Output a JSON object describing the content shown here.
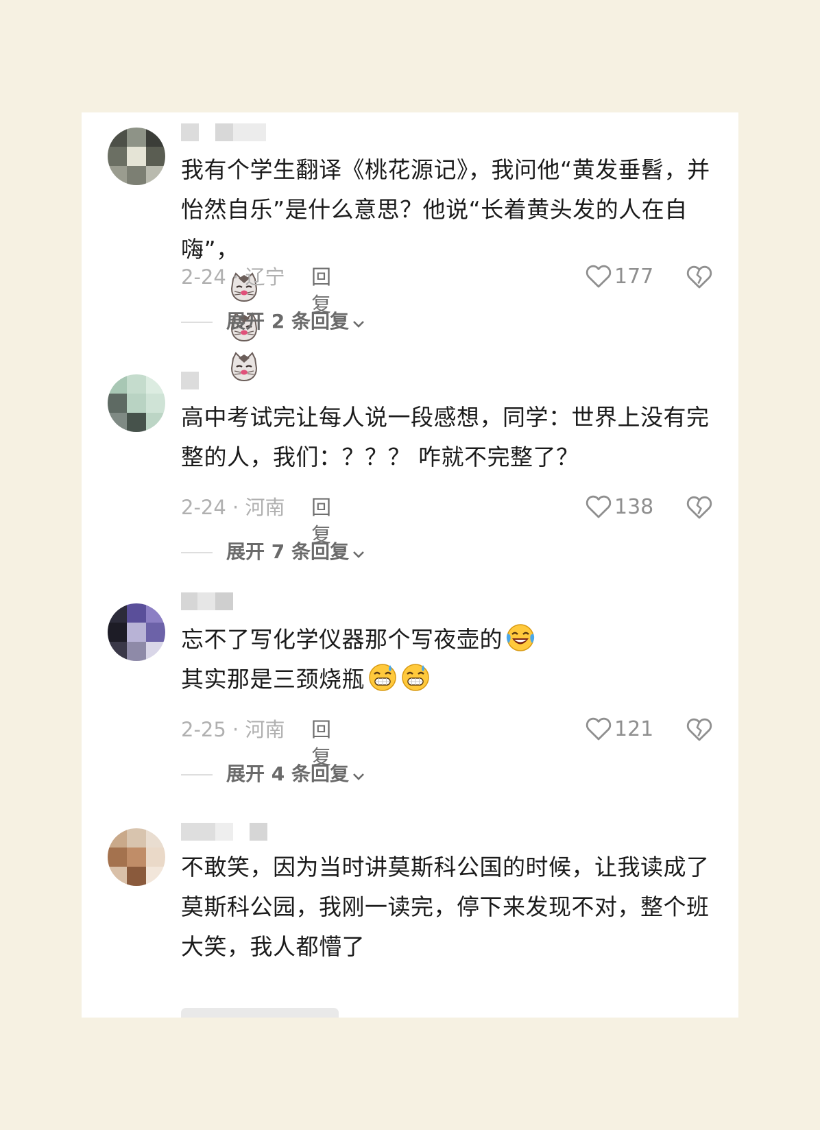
{
  "comments": [
    {
      "text": "我有个学生翻译《桃花源记》，我问他“黄发垂髫，并怡然自乐”是什么意思？他说“长着黄头发的人在自嗨”，",
      "emojis": [
        "cat-face-emoji",
        "cat-face-emoji",
        "cat-face-emoji"
      ],
      "date_loc": "2-24 · 辽宁",
      "reply_label": "回复",
      "likes": "177",
      "expand_label": "展开 2 条回复"
    },
    {
      "text": "高中考试完让每人说一段感想，同学：世界上没有完整的人，我们：？？？ 咋就不完整了？",
      "emojis": [],
      "date_loc": "2-24 · 河南",
      "reply_label": "回复",
      "likes": "138",
      "expand_label": "展开 7 条回复"
    },
    {
      "text": "忘不了写化学仪器那个写夜壶的",
      "text2": "其实那是三颈烧瓶",
      "emojis": [
        "laughing-crying-emoji"
      ],
      "emojis2": [
        "grinning-sweat-emoji",
        "grinning-sweat-emoji"
      ],
      "date_loc": "2-25 · 河南",
      "reply_label": "回复",
      "likes": "121",
      "expand_label": "展开 4 条回复"
    },
    {
      "text": "不敢笑，因为当时讲莫斯科公国的时候，让我读成了莫斯科公园，我刚一读完，停下来发现不对，整个班大笑，我人都懵了",
      "emojis": []
    }
  ],
  "icons": {
    "like": "heart-outline-icon",
    "dislike": "broken-heart-icon",
    "expand": "chevron-down-icon"
  },
  "colors": {
    "background": "#f6f1e2",
    "card": "#ffffff",
    "text": "#1b1b1b",
    "meta": "#b0b0b0"
  }
}
